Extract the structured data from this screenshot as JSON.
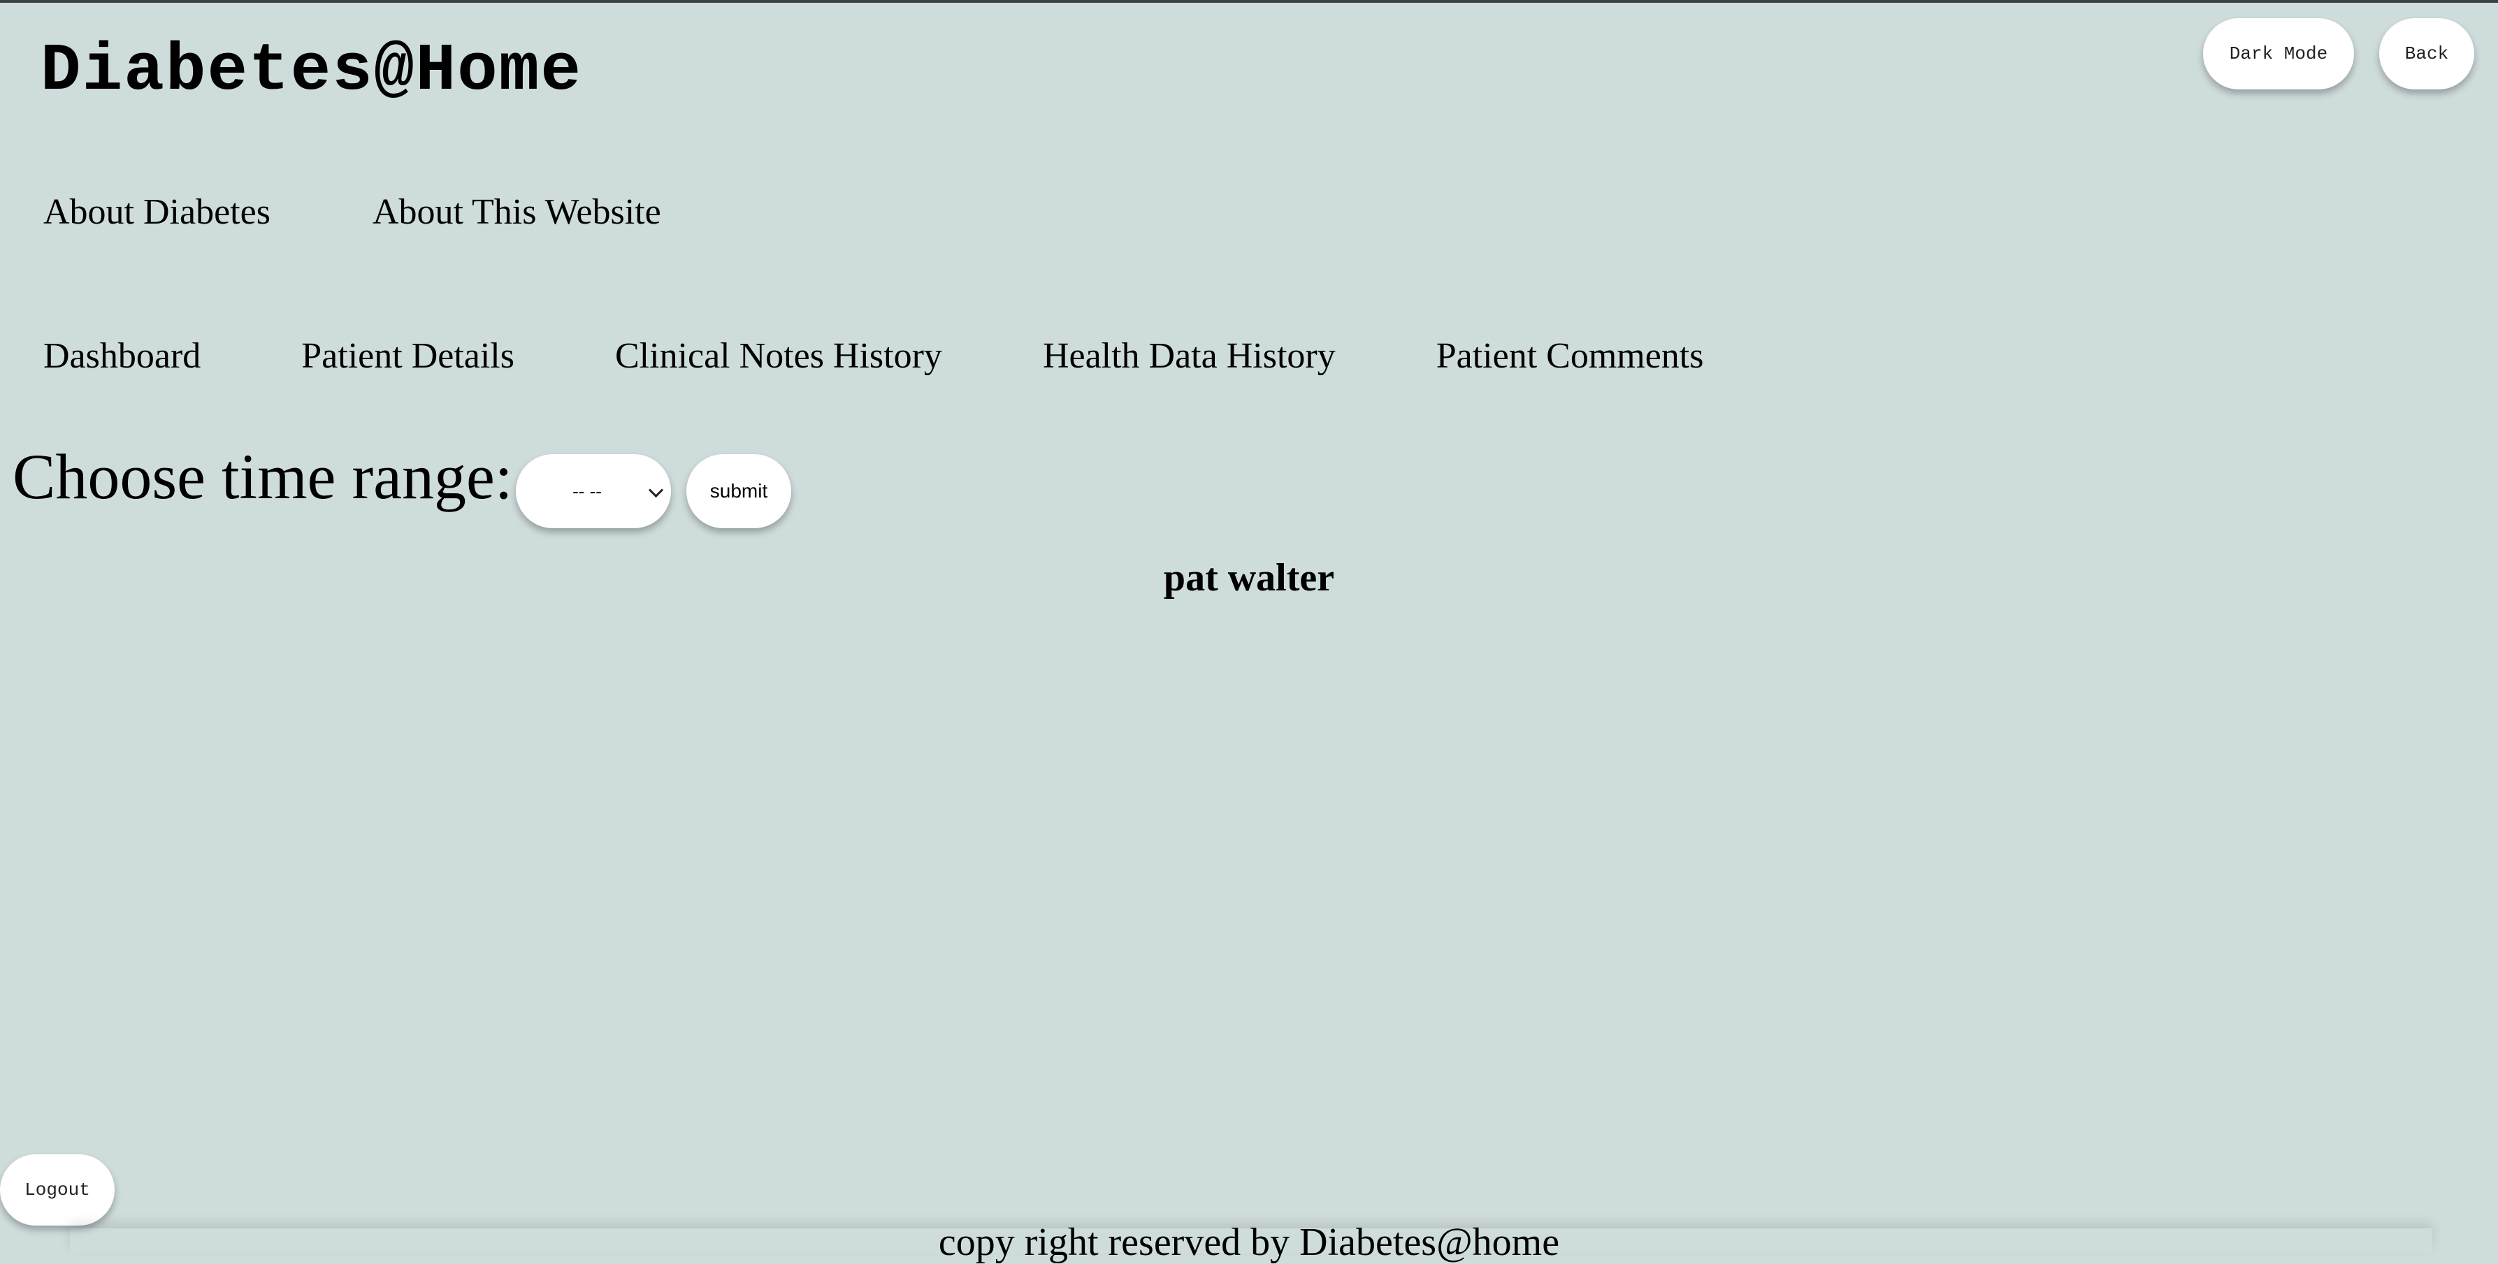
{
  "header": {
    "title": "Diabetes@Home",
    "dark_mode_label": "Dark Mode",
    "back_label": "Back"
  },
  "top_nav": [
    "About Diabetes",
    "About This Website"
  ],
  "sub_nav": [
    "Dashboard",
    "Patient Details",
    "Clinical Notes History",
    "Health Data History",
    "Patient Comments"
  ],
  "time_range": {
    "label": "Choose time range:",
    "selected": "-- --",
    "submit_label": "submit"
  },
  "patient_name": "pat walter",
  "logout_label": "Logout",
  "footer_text": "copy right reserved by Diabetes@home",
  "colors": {
    "background": "#cfdcdc",
    "button_bg": "#ffffff"
  }
}
